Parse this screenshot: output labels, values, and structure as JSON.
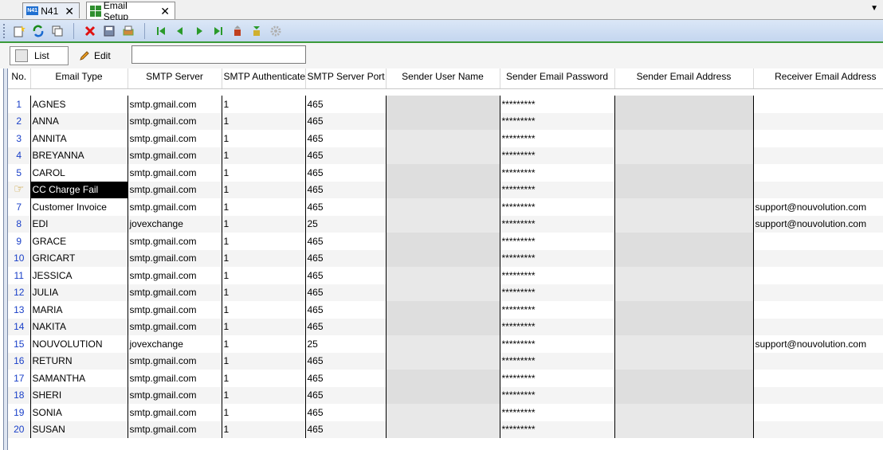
{
  "tabs": [
    {
      "label": "N41",
      "icon": "n41-app-icon"
    },
    {
      "label": "Email Setup",
      "icon": "grid-icon"
    }
  ],
  "modes": {
    "list": "List",
    "edit": "Edit"
  },
  "search": {
    "value": "",
    "placeholder": ""
  },
  "columns": [
    "No.",
    "Email Type",
    "SMTP Server",
    "SMTP Authenticate",
    "SMTP Server Port",
    "Sender User Name",
    "Sender Email Password",
    "Sender Email Address",
    "Receiver Email Address"
  ],
  "rows": [
    {
      "no": "1",
      "type": "AGNES",
      "server": "smtp.gmail.com",
      "auth": "1",
      "port": "465",
      "user": "",
      "password": "*********",
      "sender": "",
      "receiver": ""
    },
    {
      "no": "2",
      "type": "ANNA",
      "server": "smtp.gmail.com",
      "auth": "1",
      "port": "465",
      "user": "",
      "password": "*********",
      "sender": "",
      "receiver": ""
    },
    {
      "no": "3",
      "type": "ANNITA",
      "server": "smtp.gmail.com",
      "auth": "1",
      "port": "465",
      "user": "",
      "password": "*********",
      "sender": "",
      "receiver": ""
    },
    {
      "no": "4",
      "type": "BREYANNA",
      "server": "smtp.gmail.com",
      "auth": "1",
      "port": "465",
      "user": "",
      "password": "*********",
      "sender": "",
      "receiver": ""
    },
    {
      "no": "5",
      "type": "CAROL",
      "server": "smtp.gmail.com",
      "auth": "1",
      "port": "465",
      "user": "",
      "password": "*********",
      "sender": "",
      "receiver": ""
    },
    {
      "no": "",
      "type": "CC Charge Fail",
      "server": "smtp.gmail.com",
      "auth": "1",
      "port": "465",
      "user": "",
      "password": "*********",
      "sender": "",
      "receiver": "",
      "selected": true
    },
    {
      "no": "7",
      "type": "Customer Invoice",
      "server": "smtp.gmail.com",
      "auth": "1",
      "port": "465",
      "user": "",
      "password": "*********",
      "sender": "",
      "receiver": "support@nouvolution.com"
    },
    {
      "no": "8",
      "type": "EDI",
      "server": "jovexchange",
      "auth": "1",
      "port": "25",
      "user": "",
      "password": "*********",
      "sender": "",
      "receiver": "support@nouvolution.com"
    },
    {
      "no": "9",
      "type": "GRACE",
      "server": "smtp.gmail.com",
      "auth": "1",
      "port": "465",
      "user": "",
      "password": "*********",
      "sender": "",
      "receiver": ""
    },
    {
      "no": "10",
      "type": "GRICART",
      "server": "smtp.gmail.com",
      "auth": "1",
      "port": "465",
      "user": "",
      "password": "*********",
      "sender": "",
      "receiver": ""
    },
    {
      "no": "11",
      "type": "JESSICA",
      "server": "smtp.gmail.com",
      "auth": "1",
      "port": "465",
      "user": "",
      "password": "*********",
      "sender": "",
      "receiver": ""
    },
    {
      "no": "12",
      "type": "JULIA",
      "server": "smtp.gmail.com",
      "auth": "1",
      "port": "465",
      "user": "",
      "password": "*********",
      "sender": "",
      "receiver": ""
    },
    {
      "no": "13",
      "type": "MARIA",
      "server": "smtp.gmail.com",
      "auth": "1",
      "port": "465",
      "user": "",
      "password": "*********",
      "sender": "",
      "receiver": ""
    },
    {
      "no": "14",
      "type": "NAKITA",
      "server": "smtp.gmail.com",
      "auth": "1",
      "port": "465",
      "user": "",
      "password": "*********",
      "sender": "",
      "receiver": ""
    },
    {
      "no": "15",
      "type": "NOUVOLUTION",
      "server": "jovexchange",
      "auth": "1",
      "port": "25",
      "user": "",
      "password": "*********",
      "sender": "",
      "receiver": "support@nouvolution.com"
    },
    {
      "no": "16",
      "type": "RETURN",
      "server": "smtp.gmail.com",
      "auth": "1",
      "port": "465",
      "user": "",
      "password": "*********",
      "sender": "",
      "receiver": ""
    },
    {
      "no": "17",
      "type": "SAMANTHA",
      "server": "smtp.gmail.com",
      "auth": "1",
      "port": "465",
      "user": "",
      "password": "*********",
      "sender": "",
      "receiver": ""
    },
    {
      "no": "18",
      "type": "SHERI",
      "server": "smtp.gmail.com",
      "auth": "1",
      "port": "465",
      "user": "",
      "password": "*********",
      "sender": "",
      "receiver": ""
    },
    {
      "no": "19",
      "type": "SONIA",
      "server": "smtp.gmail.com",
      "auth": "1",
      "port": "465",
      "user": "",
      "password": "*********",
      "sender": "",
      "receiver": ""
    },
    {
      "no": "20",
      "type": "SUSAN",
      "server": "smtp.gmail.com",
      "auth": "1",
      "port": "465",
      "user": "",
      "password": "*********",
      "sender": "",
      "receiver": ""
    }
  ],
  "colors": {
    "accent": "#3a9a3a",
    "row_number": "#1a40c8",
    "selected": "#000000"
  }
}
